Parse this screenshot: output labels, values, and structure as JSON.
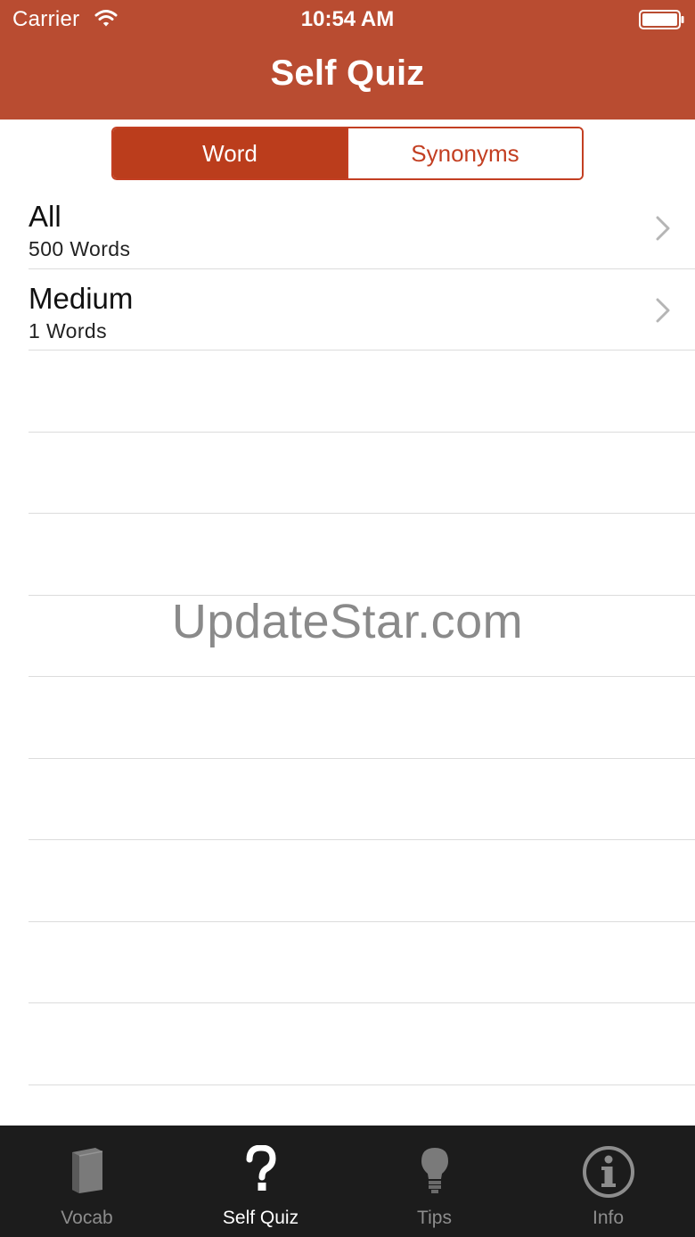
{
  "status_bar": {
    "carrier": "Carrier",
    "time": "10:54 AM"
  },
  "nav": {
    "title": "Self Quiz"
  },
  "segmented_control": {
    "segments": [
      {
        "label": "Word",
        "selected": true
      },
      {
        "label": "Synonyms",
        "selected": false
      }
    ]
  },
  "list": {
    "rows": [
      {
        "title": "All",
        "subtitle": "500 Words"
      },
      {
        "title": "Medium",
        "subtitle": "1 Words"
      }
    ]
  },
  "watermark": "UpdateStar.com",
  "tabbar": {
    "tabs": [
      {
        "label": "Vocab",
        "icon": "book-icon",
        "selected": false
      },
      {
        "label": "Self Quiz",
        "icon": "question-mark-icon",
        "selected": true
      },
      {
        "label": "Tips",
        "icon": "lightbulb-icon",
        "selected": false
      },
      {
        "label": "Info",
        "icon": "info-icon",
        "selected": false
      }
    ]
  },
  "colors": {
    "header": "#b94c31",
    "accent": "#c33f22",
    "segment_active": "#bb3d1c",
    "tabbar": "#1c1c1c",
    "tab_inactive": "#8d8d8d"
  }
}
